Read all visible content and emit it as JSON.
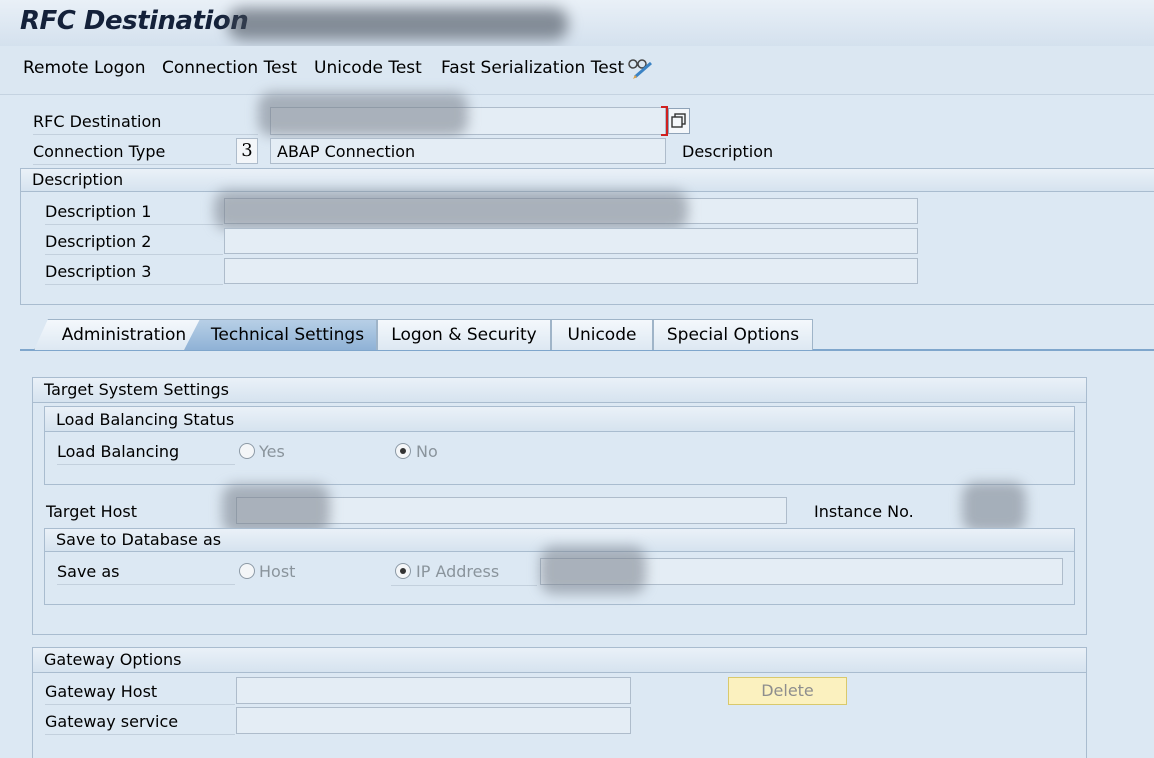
{
  "title": "RFC Destination",
  "toolbar": {
    "remote_logon": "Remote Logon",
    "connection_test": "Connection Test",
    "unicode_test": "Unicode Test",
    "fast_serialization_test": "Fast Serialization Test",
    "tool_icon": "glasses-pencil-icon"
  },
  "header": {
    "rfc_destination_label": "RFC Destination",
    "rfc_destination_value": "",
    "connection_type_label": "Connection Type",
    "connection_type_code": "3",
    "connection_type_text": "ABAP Connection",
    "description_label": "Description"
  },
  "description": {
    "title": "Description",
    "description1_label": "Description 1",
    "description2_label": "Description 2",
    "description3_label": "Description 3",
    "description2_value": "",
    "description3_value": ""
  },
  "tabs": {
    "administration": "Administration",
    "technical_settings": "Technical Settings",
    "logon_security": "Logon & Security",
    "unicode": "Unicode",
    "special_options": "Special Options",
    "active": "Technical Settings"
  },
  "target_system": {
    "title": "Target System Settings",
    "load_balancing_status": "Load Balancing Status",
    "load_balancing_label": "Load Balancing",
    "yes": "Yes",
    "no": "No",
    "load_balancing_selected": "No",
    "target_host_label": "Target Host",
    "instance_no_label": "Instance No.",
    "save_to_db_title": "Save to Database as",
    "save_as_label": "Save as",
    "host": "Host",
    "ip_address": "IP Address",
    "save_as_selected": "IP Address"
  },
  "gateway": {
    "title": "Gateway Options",
    "gateway_host_label": "Gateway Host",
    "gateway_service_label": "Gateway service",
    "delete": "Delete"
  },
  "colors": {
    "background": "#dce8f3",
    "active_tab": "#9fbfe0",
    "delete_button": "#fbf1bf"
  }
}
